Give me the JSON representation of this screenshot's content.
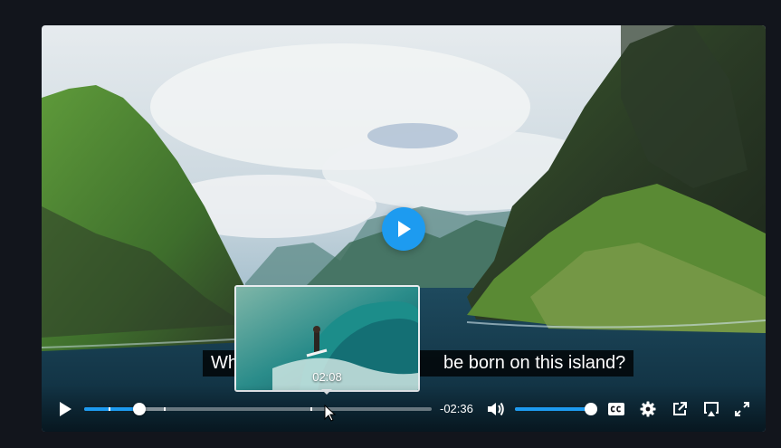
{
  "player": {
    "caption": "Wh… be born on this island?",
    "caption_left": "Wh",
    "caption_right": "be born on this island?",
    "hover_preview_time": "02:08",
    "time_remaining": "-02:36",
    "progress": 0.16,
    "buffered": 0.23,
    "hover_position": 0.65,
    "chapter_markers": [
      0.07,
      0.23,
      0.65
    ],
    "volume": 1.0,
    "accent_color": "#1d9bf0",
    "icons": {
      "big_play": "play-icon",
      "play": "play-icon",
      "volume": "volume-icon",
      "captions": "captions-icon",
      "settings": "gear-icon",
      "popout": "external-link-icon",
      "airplay": "airplay-icon",
      "fullscreen": "fullscreen-icon"
    }
  }
}
